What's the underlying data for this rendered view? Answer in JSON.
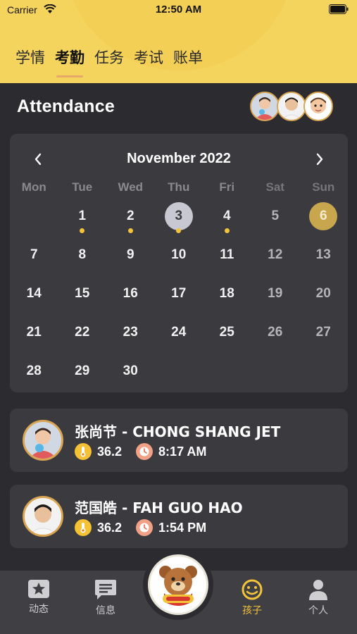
{
  "status_bar": {
    "carrier": "Carrier",
    "time": "12:50 AM",
    "wifi_icon": "wifi-icon",
    "battery_icon": "battery-icon"
  },
  "tabs": [
    {
      "label": "学情",
      "active": false
    },
    {
      "label": "考勤",
      "active": true
    },
    {
      "label": "任务",
      "active": false
    },
    {
      "label": "考试",
      "active": false
    },
    {
      "label": "账单",
      "active": false
    }
  ],
  "page_title": "Attendance",
  "calendar": {
    "month_label": "November 2022",
    "prev_icon": "chevron-left-icon",
    "next_icon": "chevron-right-icon",
    "weekdays": [
      "Mon",
      "Tue",
      "Wed",
      "Thu",
      "Fri",
      "Sat",
      "Sun"
    ],
    "first_weekday_offset": 1,
    "days_in_month": 30,
    "today": 3,
    "selected": 6,
    "marked_days": [
      1,
      2,
      3,
      4
    ]
  },
  "students": [
    {
      "name": "张尚节 - CHONG SHANG JET",
      "temperature": "36.2",
      "time": "8:17 AM"
    },
    {
      "name": "范国皓 - FAH GUO HAO",
      "temperature": "36.2",
      "time": "1:54 PM"
    }
  ],
  "bottom_nav": [
    {
      "label": "动态",
      "icon": "star-board-icon",
      "active": false
    },
    {
      "label": "信息",
      "icon": "message-icon",
      "active": false
    },
    {
      "label": "孩子",
      "icon": "smiley-icon",
      "active": true
    },
    {
      "label": "个人",
      "icon": "person-icon",
      "active": false
    }
  ],
  "colors": {
    "header": "#f5d45e",
    "background": "#2c2c30",
    "card": "#3a3a3f",
    "accent": "#f3c339",
    "avatar_border": "#d9a552"
  }
}
